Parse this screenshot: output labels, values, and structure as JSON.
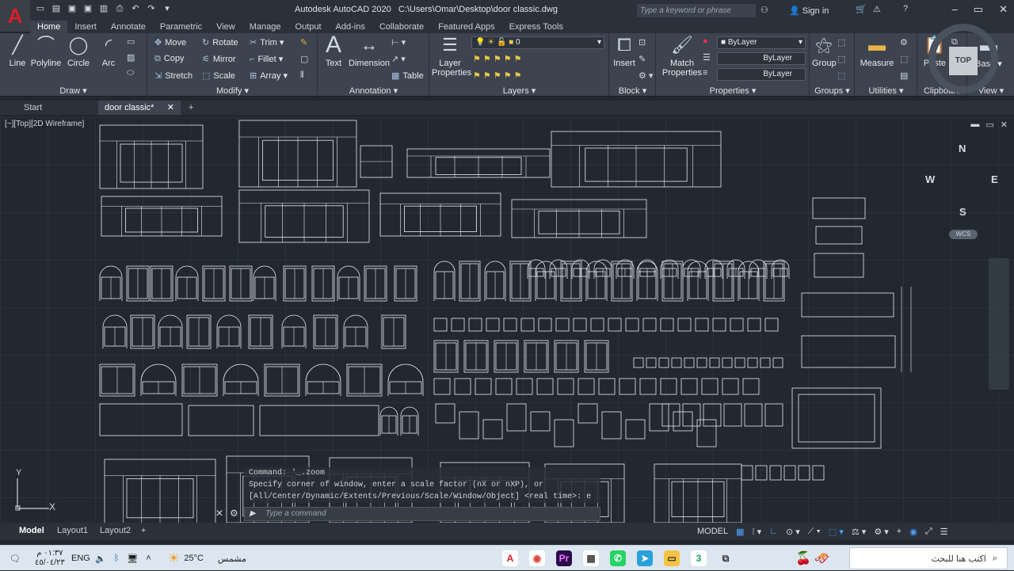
{
  "app": {
    "logo": "A",
    "title": "Autodesk AutoCAD 2020",
    "file_path": "C:\\Users\\Omar\\Desktop\\door classic.dwg",
    "search_placeholder": "Type a keyword or phrase",
    "signin": "Sign in"
  },
  "ribbon_tabs": [
    "Home",
    "Insert",
    "Annotate",
    "Parametric",
    "View",
    "Manage",
    "Output",
    "Add-ins",
    "Collaborate",
    "Featured Apps",
    "Express Tools"
  ],
  "panels": {
    "draw": {
      "title": "Draw",
      "line": "Line",
      "polyline": "Polyline",
      "circle": "Circle",
      "arc": "Arc"
    },
    "modify": {
      "title": "Modify",
      "move": "Move",
      "rotate": "Rotate",
      "trim": "Trim",
      "copy": "Copy",
      "mirror": "Mirror",
      "fillet": "Fillet",
      "stretch": "Stretch",
      "scale": "Scale",
      "array": "Array"
    },
    "annotation": {
      "title": "Annotation",
      "text": "Text",
      "dimension": "Dimension",
      "table": "Table"
    },
    "layers": {
      "title": "Layers",
      "layer_properties_1": "Layer",
      "layer_properties_2": "Properties",
      "current_layer": "0"
    },
    "block": {
      "title": "Block",
      "insert": "Insert"
    },
    "properties": {
      "title": "Properties",
      "match_1": "Match",
      "match_2": "Properties",
      "color": "ByLayer",
      "linetype": "ByLayer",
      "lineweight": "ByLayer"
    },
    "groups": {
      "title": "Groups",
      "group": "Group"
    },
    "utilities": {
      "title": "Utilities",
      "measure": "Measure"
    },
    "clipboard": {
      "title": "Clipboard",
      "paste": "Paste"
    },
    "view": {
      "title": "View",
      "base": "Base"
    }
  },
  "doc_tabs": {
    "start": "Start",
    "active": "door classic*"
  },
  "viewport": {
    "label": "[−][Top][2D Wireframe]"
  },
  "viewcube": {
    "north": "N",
    "south": "S",
    "east": "E",
    "west": "W",
    "face": "TOP",
    "wcs": "WCS"
  },
  "ucs": {
    "x": "X",
    "y": "Y"
  },
  "command": {
    "history_1": "Command: '_.zoom",
    "history_2": "Specify corner of window, enter a scale factor (nX or nXP), or",
    "history_3": "[All/Center/Dynamic/Extents/Previous/Scale/Window/Object] <real time>: e",
    "placeholder": "Type a command"
  },
  "layout_tabs": [
    "Model",
    "Layout1",
    "Layout2"
  ],
  "status": {
    "space": "MODEL"
  },
  "taskbar": {
    "time": "٠١:٣٧ م",
    "date": "٤٥/٠٤/٢٣",
    "lang": "ENG",
    "weather_temp": "25°C",
    "weather_text": "مشمس",
    "search": "اكتب هنا للبحث"
  },
  "colors": {
    "accent": "#d8202a",
    "ribbon": "#3d444f",
    "canvas": "#212830",
    "line_art": "#e8ecf0"
  }
}
